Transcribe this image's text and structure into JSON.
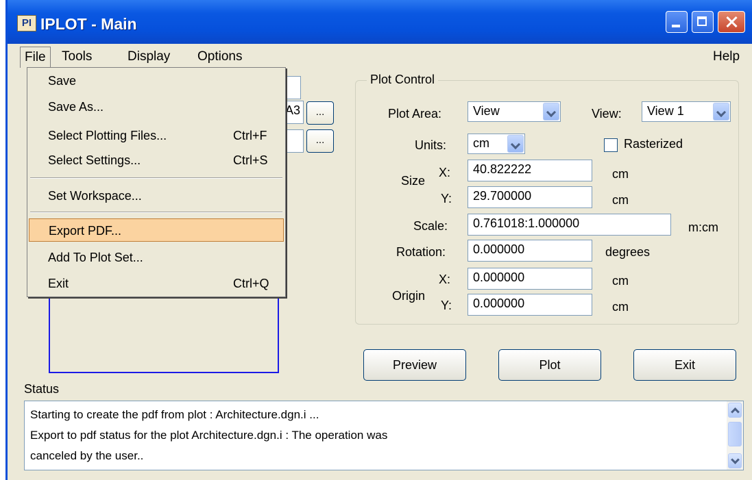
{
  "window": {
    "title": "IPLOT - Main",
    "icon_text": "PI"
  },
  "menubar": {
    "items": [
      "File",
      "Tools",
      "Display",
      "Options"
    ],
    "help": "Help"
  },
  "file_menu": {
    "save": "Save",
    "save_as": "Save As...",
    "select_plotting_files": {
      "label": "Select Plotting Files...",
      "shortcut": "Ctrl+F"
    },
    "select_settings": {
      "label": "Select Settings...",
      "shortcut": "Ctrl+S"
    },
    "set_workspace": "Set Workspace...",
    "export_pdf": "Export PDF...",
    "add_to_plot_set": "Add To Plot Set...",
    "exit": {
      "label": "Exit",
      "shortcut": "Ctrl+Q"
    }
  },
  "left_fields": {
    "field2_value_tail": "A3",
    "browse": "..."
  },
  "plot_control": {
    "legend": "Plot Control",
    "plot_area_label": "Plot Area:",
    "plot_area_value": "View",
    "view_label": "View:",
    "view_value": "View 1",
    "units_label": "Units:",
    "units_value": "cm",
    "rasterized_label": "Rasterized",
    "size_label": "Size",
    "x_label": "X:",
    "y_label": "Y:",
    "size_x": "40.822222",
    "size_y": "29.700000",
    "unit_cm": "cm",
    "scale_label": "Scale:",
    "scale_value": "0.761018:1.000000",
    "scale_unit": "m:cm",
    "rotation_label": "Rotation:",
    "rotation_value": "0.000000",
    "rotation_unit": "degrees",
    "origin_label": "Origin",
    "origin_x": "0.000000",
    "origin_y": "0.000000"
  },
  "buttons": {
    "preview": "Preview",
    "plot": "Plot",
    "exit": "Exit"
  },
  "status": {
    "label": "Status",
    "lines": [
      "Starting to create the pdf from plot : Architecture.dgn.i ...",
      "Export to pdf status for the plot Architecture.dgn.i : The operation was",
      " canceled by the user.."
    ]
  },
  "colors": {
    "titlebar": "#0650db",
    "highlight": "#fbd3a0",
    "preview_border": "#1a1ae6"
  }
}
